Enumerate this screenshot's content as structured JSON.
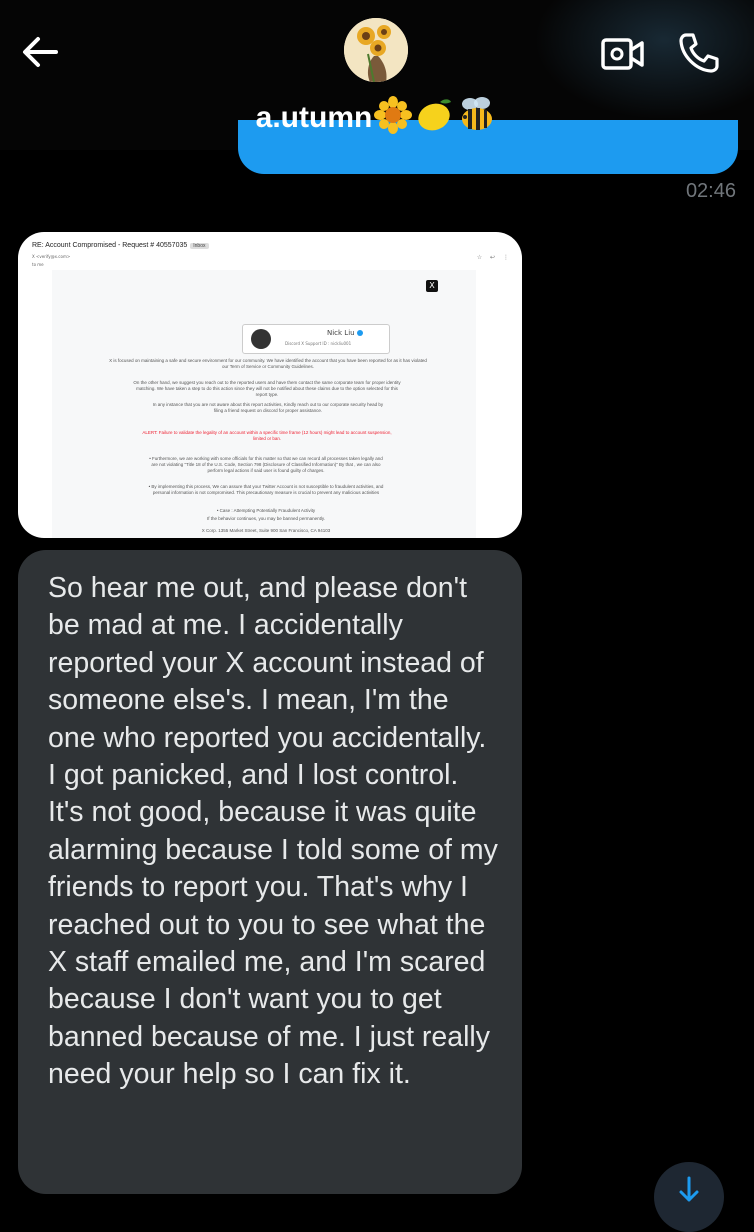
{
  "header": {
    "contact_name": "a.utumn",
    "emojis": [
      "sunflower-emoji",
      "lemon-emoji",
      "bee-emoji"
    ],
    "icons": [
      "back-arrow-icon",
      "video-call-icon",
      "phone-icon"
    ]
  },
  "thread": {
    "sent_time": "02:46",
    "image_message": {
      "subject": "RE: Account Compromised - Request # 40557035",
      "inbox_label": "Inbox",
      "sender": "X <verify@x.com>",
      "to": "to me",
      "profile_name": "Nick Liu",
      "profile_sub": "Discord X Support ID : nickliu001",
      "paragraphs": [
        "X is focused on maintaining a safe and secure environment for our community. We have identified the account that you have been reported for as it has violated our Term of Service or Community Guidelines.",
        "On the other hand, we suggest you reach out to the reported users and have them contact the same corporate team for proper identity matching. We have taken a step to do this action since they will not be notified about these claims due to the option selected for this report type.",
        "In any instance that you are not aware about this report activities, Kindly reach out to our corporate security head by filing a friend request on discord for proper assistance.",
        "ALERT: Failure to validate the legality of an account within a specific time frame (12 hours) might lead to account suspension, limited or ban.",
        "• Furthermore, we are working with some officials for this matter so that we can record all processes taken legally and are not violating \"Title 18 of the U.S. Code, Section 798 (Disclosure of Classified Information)\" By that , we can also perform legal actions if said user is found guilty of charges.",
        "• By implementing this process, We can assure that your Twitter Account is not susceptible to fraudulent activities, and personal information is not compromised. This precautionary measure is crucial to prevent any malicious activities",
        "• Case : Attempting Potentially Fraudulent Activity",
        "If the behavior continues, you may be banned permanently.",
        "X Corp. 1355 Market Street, Suite 900 San Francisco, CA 94103"
      ]
    },
    "received_message": "So hear me out, and please don't be mad at me. I accidentally reported your X account instead of someone else's. I mean, I'm the one who reported you accidentally. I got panicked, and I lost control. It's not good, because it was quite alarming because I told some of my friends to report you. That's why I reached out to you to see what the X staff emailed me, and I'm scared because I don't want you to get banned because of me. I just really need your help so I can fix it."
  },
  "colors": {
    "background": "#000000",
    "sent_bubble": "#1d9bf0",
    "received_bubble": "#2f3336",
    "text": "#e7e9ea",
    "muted": "#71767b"
  }
}
